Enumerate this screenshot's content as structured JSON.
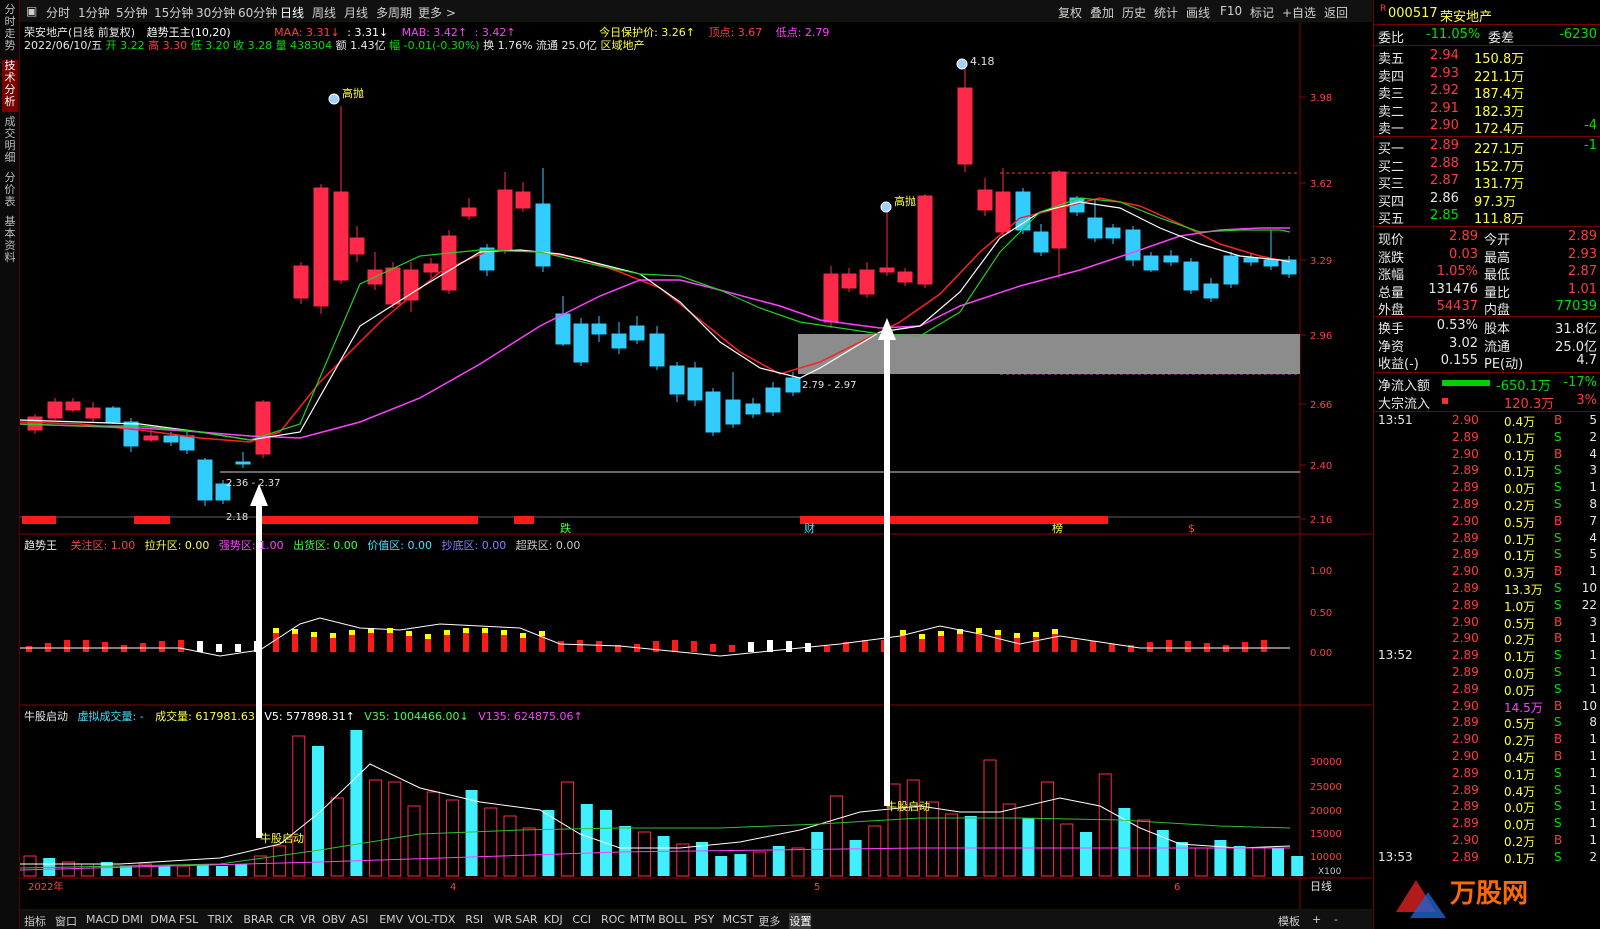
{
  "left_tabs": [
    "分时走势",
    "技术分析",
    "成交明细",
    "分价表",
    "基本资料"
  ],
  "toolbar": {
    "periods": [
      "分时",
      "1分钟",
      "5分钟",
      "15分钟",
      "30分钟",
      "60分钟",
      "日线",
      "周线",
      "月线",
      "多周期",
      "更多 >"
    ],
    "active_period": "日线",
    "right_items": [
      "复权",
      "叠加",
      "历史",
      "统计",
      "画线",
      "F10",
      "标记",
      "+自选",
      "返回"
    ]
  },
  "header": {
    "line1": "荣安地产(日线 前复权)",
    "indicator": "趋势王主(10,20)",
    "maa": "MAA: 3.31↓",
    "ma2": ": 3.31↓",
    "mab": "MAB: 3.42↑",
    "ma4": ": 3.42↑",
    "protect": "今日保护价: 3.26↑",
    "top": "顶点: 3.67",
    "low": "低点: 2.79",
    "date": "2022/06/10/五",
    "open": "开 3.22",
    "high": "高 3.30",
    "low2": "低 3.20",
    "close": "收 3.28",
    "vol": "量 438304",
    "amount": "额 1.43亿",
    "change": "幅 -0.01(-0.30%)",
    "turnover": "换 1.76%",
    "float": "流通 25.0亿",
    "sector": "区域地产"
  },
  "main_chart": {
    "y_ticks": [
      "3.98",
      "3.62",
      "3.29",
      "2.96",
      "2.66",
      "2.40",
      "2.16"
    ],
    "annotations": {
      "gaopao1": "高抛",
      "gaopao2": "高抛",
      "peak": "4.18",
      "low_label": "2.18",
      "range1": "2.36 - 2.37",
      "range2": "2.79 - 2.97"
    },
    "band_labels": [
      "跌",
      "财",
      "榜",
      "$"
    ]
  },
  "ind1": {
    "title": "趋势王",
    "focus": "关注区: 1.00",
    "rise": "拉升区: 0.00",
    "strong": "强势区: 1.00",
    "ship": "出货区: 0.00",
    "value": "价值区: 0.00",
    "bottom": "抄底区: 0.00",
    "over": "超跌区: 0.00",
    "y_ticks": [
      "1.00",
      "0.50",
      "0.00"
    ]
  },
  "ind2": {
    "title": "牛股启动",
    "virt": "虚拟成交量: -",
    "vol": "成交量: 617981.63",
    "v5": "V5: 577898.31↑",
    "v35": "V35: 1004466.00↓",
    "v135": "V135: 624875.06↑",
    "y_ticks": [
      "30000",
      "25000",
      "20000",
      "15000",
      "10000"
    ],
    "unit": "X100",
    "signal1": "牛股启动",
    "signal2": "牛股启动"
  },
  "x_axis": {
    "year": "2022年",
    "months": [
      "4",
      "5",
      "6"
    ],
    "period": "日线"
  },
  "bottom_tabs": [
    "指标",
    "窗口",
    "MACD",
    "DMI",
    "DMA",
    "FSL",
    "TRIX",
    "BRAR",
    "CR",
    "VR",
    "OBV",
    "ASI",
    "EMV",
    "VOL-TDX",
    "RSI",
    "WR",
    "SAR",
    "KDJ",
    "CCI",
    "ROC",
    "MTM",
    "BOLL",
    "PSY",
    "MCST",
    "更多",
    "设置"
  ],
  "bottom_right": [
    "模板",
    "+",
    "-"
  ],
  "quote": {
    "code": "000517",
    "name": "荣安地产",
    "weibi_label": "委比",
    "weibi": "-11.05%",
    "weicha_label": "委差",
    "weicha": "-6230",
    "asks": [
      {
        "label": "卖五",
        "price": "2.94",
        "vol": "150.8万",
        "chg": ""
      },
      {
        "label": "卖四",
        "price": "2.93",
        "vol": "221.1万",
        "chg": ""
      },
      {
        "label": "卖三",
        "price": "2.92",
        "vol": "187.4万",
        "chg": ""
      },
      {
        "label": "卖二",
        "price": "2.91",
        "vol": "182.3万",
        "chg": ""
      },
      {
        "label": "卖一",
        "price": "2.90",
        "vol": "172.4万",
        "chg": "-4"
      }
    ],
    "bids": [
      {
        "label": "买一",
        "price": "2.89",
        "vol": "227.1万",
        "chg": "-1"
      },
      {
        "label": "买二",
        "price": "2.88",
        "vol": "152.7万",
        "chg": ""
      },
      {
        "label": "买三",
        "price": "2.87",
        "vol": "131.7万",
        "chg": ""
      },
      {
        "label": "买四",
        "price": "2.86",
        "vol": "97.3万",
        "chg": ""
      },
      {
        "label": "买五",
        "price": "2.85",
        "vol": "111.8万",
        "chg": ""
      }
    ],
    "stats": [
      {
        "l1": "现价",
        "v1": "2.89",
        "l2": "今开",
        "v2": "2.89"
      },
      {
        "l1": "涨跌",
        "v1": "0.03",
        "l2": "最高",
        "v2": "2.93"
      },
      {
        "l1": "涨幅",
        "v1": "1.05%",
        "l2": "最低",
        "v2": "2.87"
      },
      {
        "l1": "总量",
        "v1": "131476",
        "l2": "量比",
        "v2": "1.01"
      },
      {
        "l1": "外盘",
        "v1": "54437",
        "l2": "内盘",
        "v2": "77039"
      },
      {
        "l1": "换手",
        "v1": "0.53%",
        "l2": "股本",
        "v2": "31.8亿"
      },
      {
        "l1": "净资",
        "v1": "3.02",
        "l2": "流通",
        "v2": "25.0亿"
      },
      {
        "l1": "收益(-)",
        "v1": "0.155",
        "l2": "PE(动)",
        "v2": "4.7"
      }
    ],
    "netflow_label": "净流入额",
    "netflow": "-650.1万",
    "netflow_pct": "-17%",
    "block_label": "大宗流入",
    "block": "120.3万",
    "block_pct": "3%"
  },
  "ticks": [
    {
      "t": "13:51",
      "p": "2.90",
      "v": "0.4万",
      "d": "B",
      "n": "5"
    },
    {
      "t": "",
      "p": "2.89",
      "v": "0.1万",
      "d": "S",
      "n": "2"
    },
    {
      "t": "",
      "p": "2.90",
      "v": "0.1万",
      "d": "B",
      "n": "4"
    },
    {
      "t": "",
      "p": "2.89",
      "v": "0.1万",
      "d": "S",
      "n": "3"
    },
    {
      "t": "",
      "p": "2.89",
      "v": "0.0万",
      "d": "S",
      "n": "1"
    },
    {
      "t": "",
      "p": "2.89",
      "v": "0.2万",
      "d": "S",
      "n": "8"
    },
    {
      "t": "",
      "p": "2.90",
      "v": "0.5万",
      "d": "B",
      "n": "7"
    },
    {
      "t": "",
      "p": "2.89",
      "v": "0.1万",
      "d": "S",
      "n": "4"
    },
    {
      "t": "",
      "p": "2.89",
      "v": "0.1万",
      "d": "S",
      "n": "5"
    },
    {
      "t": "",
      "p": "2.90",
      "v": "0.3万",
      "d": "B",
      "n": "1"
    },
    {
      "t": "",
      "p": "2.89",
      "v": "13.3万",
      "d": "S",
      "n": "10"
    },
    {
      "t": "",
      "p": "2.89",
      "v": "1.0万",
      "d": "S",
      "n": "22"
    },
    {
      "t": "",
      "p": "2.90",
      "v": "0.5万",
      "d": "B",
      "n": "3"
    },
    {
      "t": "",
      "p": "2.90",
      "v": "0.2万",
      "d": "B",
      "n": "1"
    },
    {
      "t": "13:52",
      "p": "2.89",
      "v": "0.1万",
      "d": "S",
      "n": "1"
    },
    {
      "t": "",
      "p": "2.89",
      "v": "0.0万",
      "d": "S",
      "n": "1"
    },
    {
      "t": "",
      "p": "2.89",
      "v": "0.0万",
      "d": "S",
      "n": "1"
    },
    {
      "t": "",
      "p": "2.90",
      "v": "14.5万",
      "d": "B",
      "n": "10"
    },
    {
      "t": "",
      "p": "2.89",
      "v": "0.5万",
      "d": "S",
      "n": "8"
    },
    {
      "t": "",
      "p": "2.90",
      "v": "0.2万",
      "d": "B",
      "n": "1"
    },
    {
      "t": "",
      "p": "2.90",
      "v": "0.4万",
      "d": "B",
      "n": "1"
    },
    {
      "t": "",
      "p": "2.89",
      "v": "0.1万",
      "d": "S",
      "n": "1"
    },
    {
      "t": "",
      "p": "2.89",
      "v": "0.4万",
      "d": "S",
      "n": "1"
    },
    {
      "t": "",
      "p": "2.89",
      "v": "0.0万",
      "d": "S",
      "n": "1"
    },
    {
      "t": "",
      "p": "2.89",
      "v": "0.0万",
      "d": "S",
      "n": "1"
    },
    {
      "t": "",
      "p": "2.90",
      "v": "0.2万",
      "d": "B",
      "n": "1"
    },
    {
      "t": "13:53",
      "p": "2.89",
      "v": "0.1万",
      "d": "S",
      "n": "2"
    }
  ],
  "watermark": "万股网"
}
